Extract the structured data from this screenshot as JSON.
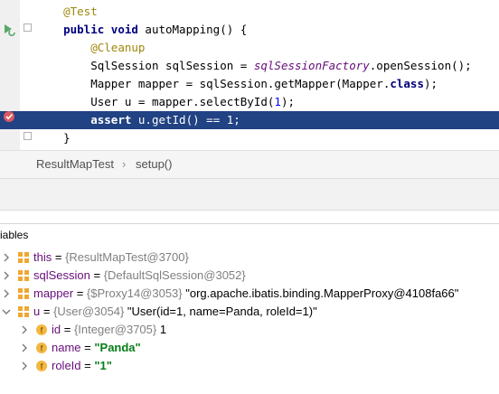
{
  "editor": {
    "lines": [
      {
        "tokens": [
          {
            "cls": "ann",
            "text": "@Test"
          }
        ],
        "indent": "    "
      },
      {
        "tokens": [
          {
            "cls": "kw",
            "text": "public void "
          },
          {
            "cls": "plain",
            "text": "autoMapping() {"
          }
        ],
        "indent": "    "
      },
      {
        "tokens": [
          {
            "cls": "ann",
            "text": "@Cleanup"
          }
        ],
        "indent": "        "
      },
      {
        "tokens": [
          {
            "cls": "plain",
            "text": "SqlSession sqlSession = "
          },
          {
            "cls": "field",
            "text": "sqlSessionFactory"
          },
          {
            "cls": "plain",
            "text": ".openSession();"
          }
        ],
        "indent": "        "
      },
      {
        "tokens": [
          {
            "cls": "plain",
            "text": "Mapper mapper = sqlSession.getMapper(Mapper."
          },
          {
            "cls": "kw",
            "text": "class"
          },
          {
            "cls": "plain",
            "text": ");"
          }
        ],
        "indent": "        "
      },
      {
        "tokens": [
          {
            "cls": "plain",
            "text": "User u = mapper.selectById("
          },
          {
            "cls": "num",
            "text": "1"
          },
          {
            "cls": "plain",
            "text": ");"
          }
        ],
        "indent": "        "
      },
      {
        "tokens": [
          {
            "cls": "kw",
            "text": "assert "
          },
          {
            "cls": "plain",
            "text": "u.getId() == "
          },
          {
            "cls": "num",
            "text": "1"
          },
          {
            "cls": "plain",
            "text": ";"
          }
        ],
        "indent": "        ",
        "highlighted": true
      },
      {
        "tokens": [
          {
            "cls": "plain",
            "text": "}"
          }
        ],
        "indent": "    "
      }
    ],
    "run_icon": "run-test-icon",
    "breakpoint_icon": "breakpoint-icon",
    "highlight_color": "#214283"
  },
  "breadcrumbs": {
    "class_name": "ResultMapTest",
    "method_name": "setup()",
    "separator": "›"
  },
  "variables_panel": {
    "title": "riables",
    "rows": [
      {
        "name": "this",
        "eq": " = ",
        "type": "{ResultMapTest@3700}",
        "value": "",
        "str": "",
        "icon": "object-icon",
        "level": 0,
        "expanded": false
      },
      {
        "name": "sqlSession",
        "eq": " = ",
        "type": "{DefaultSqlSession@3052}",
        "value": "",
        "str": "",
        "icon": "object-icon",
        "level": 0,
        "expanded": false
      },
      {
        "name": "mapper",
        "eq": " = ",
        "type": "{$Proxy14@3053}",
        "value": " \"org.apache.ibatis.binding.MapperProxy@4108fa66\"",
        "str": "",
        "icon": "object-icon",
        "level": 0,
        "expanded": false
      },
      {
        "name": "u",
        "eq": " = ",
        "type": "{User@3054}",
        "value": " \"User(id=1, name=Panda, roleId=1)\"",
        "str": "",
        "icon": "object-icon",
        "level": 0,
        "expanded": true
      },
      {
        "name": "id",
        "eq": " = ",
        "type": "{Integer@3705}",
        "value": " 1",
        "str": "",
        "icon": "field-icon",
        "level": 1,
        "expanded": false
      },
      {
        "name": "name",
        "eq": " = ",
        "type": "",
        "value": "",
        "str": "\"Panda\"",
        "icon": "field-icon",
        "level": 1,
        "expanded": false
      },
      {
        "name": "roleId",
        "eq": " = ",
        "type": "",
        "value": "",
        "str": "\"1\"",
        "icon": "field-icon",
        "level": 1,
        "expanded": false
      }
    ]
  }
}
